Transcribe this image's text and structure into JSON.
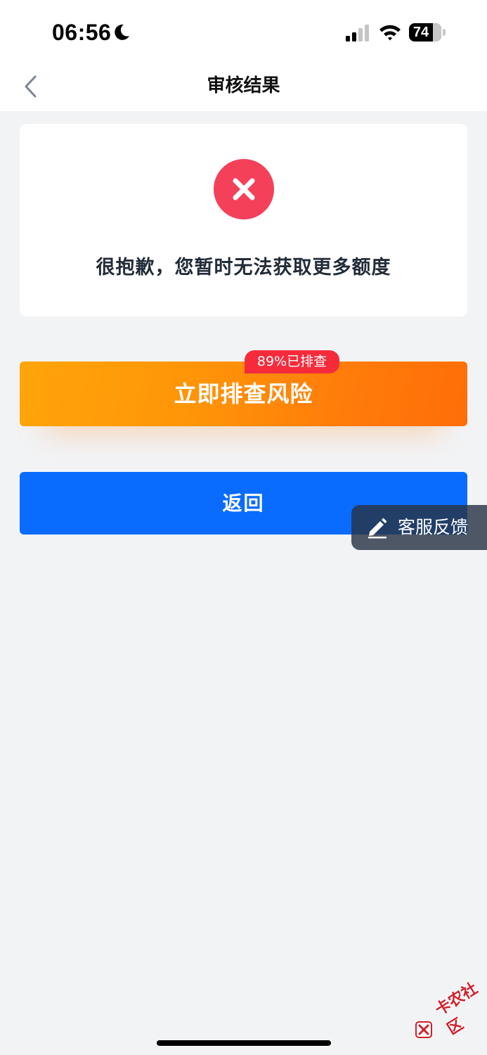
{
  "status_bar": {
    "time": "06:56",
    "battery": "74"
  },
  "nav": {
    "title": "审核结果"
  },
  "result": {
    "message": "很抱歉，您暂时无法获取更多额度"
  },
  "risk_check": {
    "label": "立即排查风险",
    "badge": "89%已排查"
  },
  "return_button": {
    "label": "返回"
  },
  "feedback": {
    "label": "客服反馈"
  },
  "watermark": {
    "text": "卡农社区"
  },
  "colors": {
    "accent_blue": "#0a6cff",
    "orange": "#ff8a08",
    "error_red": "#f5405a",
    "badge_red": "#f52b3c"
  }
}
